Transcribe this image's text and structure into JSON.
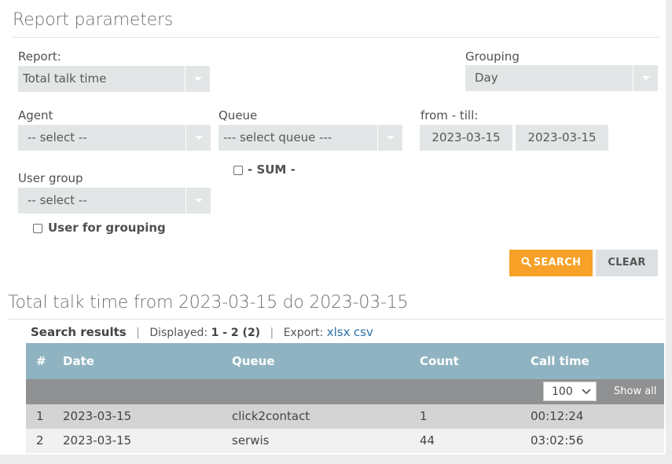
{
  "report_params": {
    "title": "Report parameters",
    "report": {
      "label": "Report:",
      "value": "Total talk time"
    },
    "grouping": {
      "label": "Grouping",
      "value": "Day"
    },
    "agent": {
      "label": "Agent",
      "value": "-- select --"
    },
    "queue": {
      "label": "Queue",
      "value": "--- select queue ---"
    },
    "dates": {
      "label": "from - till:",
      "from": "2023-03-15",
      "till": "2023-03-15"
    },
    "user_group": {
      "label": "User group",
      "value": "-- select --"
    },
    "sum": {
      "label": "- SUM -",
      "checked": false
    },
    "user_for_grouping": {
      "label": "User for grouping",
      "checked": false
    },
    "search_button": "SEARCH",
    "clear_button": "CLEAR"
  },
  "results": {
    "title": "Total talk time from 2023-03-15 do 2023-03-15",
    "search_results_label": "Search results",
    "displayed_label": "Displayed:",
    "displayed_value": "1 - 2 (2)",
    "export_label": "Export:",
    "export_links": [
      "xlsx",
      "csv"
    ],
    "columns": [
      "#",
      "Date",
      "Queue",
      "Count",
      "Call time"
    ],
    "per_page": "100",
    "show_all": "Show all",
    "rows": [
      [
        "1",
        "2023-03-15",
        "click2contact",
        "1",
        "00:12:24"
      ],
      [
        "2",
        "2023-03-15",
        "serwis",
        "44",
        "03:02:56"
      ]
    ]
  },
  "colors": {
    "accent": "#f7a128",
    "table_header": "#8fb3c1",
    "pager_bar": "#8f9192",
    "link": "#2f6fa8"
  }
}
